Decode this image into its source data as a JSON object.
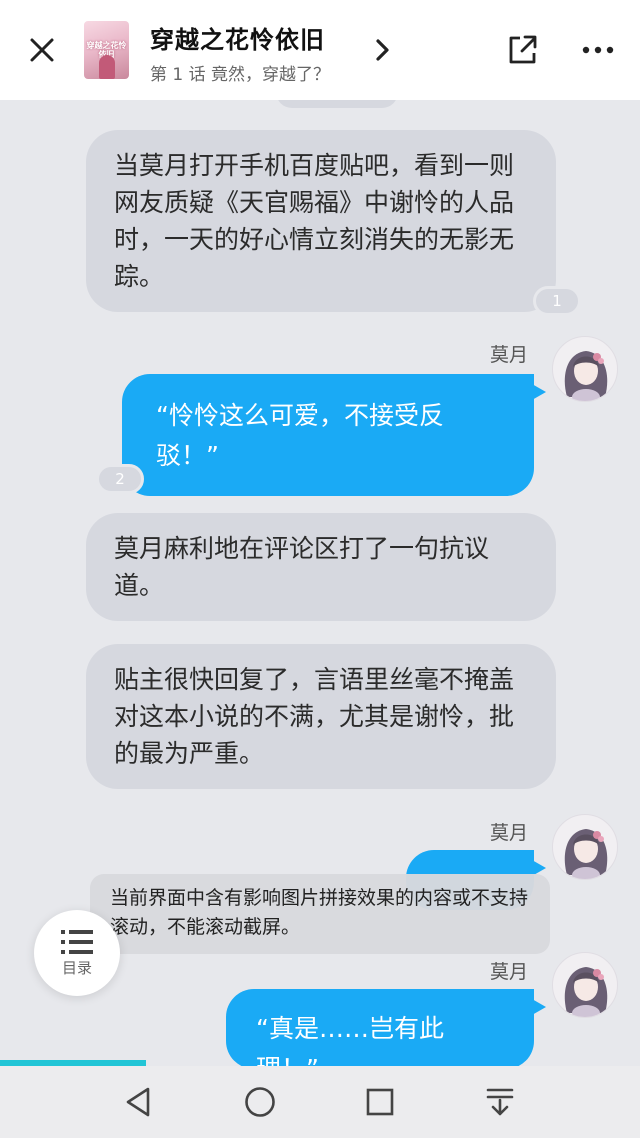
{
  "header": {
    "title": "穿越之花怜依旧",
    "subtitle": "第 1 话 竟然，穿越了？",
    "cover_text": "穿越之花怜依旧"
  },
  "messages": {
    "m1": {
      "text": "当莫月打开手机百度贴吧，看到一则网友质疑《天官赐福》中谢怜的人品时，一天的好心情立刻消失的无影无踪。",
      "count": "1"
    },
    "m2": {
      "sender": "莫月",
      "text": "“怜怜这么可爱，不接受反驳！”",
      "count": "2"
    },
    "m3": {
      "text": "莫月麻利地在评论区打了一句抗议道。"
    },
    "m4": {
      "text": "贴主很快回复了，言语里丝毫不掩盖对这本小说的不满，尤其是谢怜，批的最为严重。"
    },
    "m5": {
      "sender": "莫月"
    },
    "m6": {
      "sender": "莫月",
      "text": "“真是……岂有此理！”"
    }
  },
  "toast": {
    "text": "当前界面中含有影响图片拼接效果的内容或不支持滚动，不能滚动截屏。"
  },
  "toc": {
    "label": "目录"
  },
  "icons": [
    "close-icon",
    "chevron-right-icon",
    "share-icon",
    "more-icon",
    "list-icon",
    "back-icon",
    "home-icon",
    "recents-icon",
    "pull-down-icon"
  ],
  "colors": {
    "user_bubble": "#1aaaf5",
    "narration_bubble": "#d6d8df",
    "progress": "#22c5d6"
  },
  "reading_progress": 0.23
}
